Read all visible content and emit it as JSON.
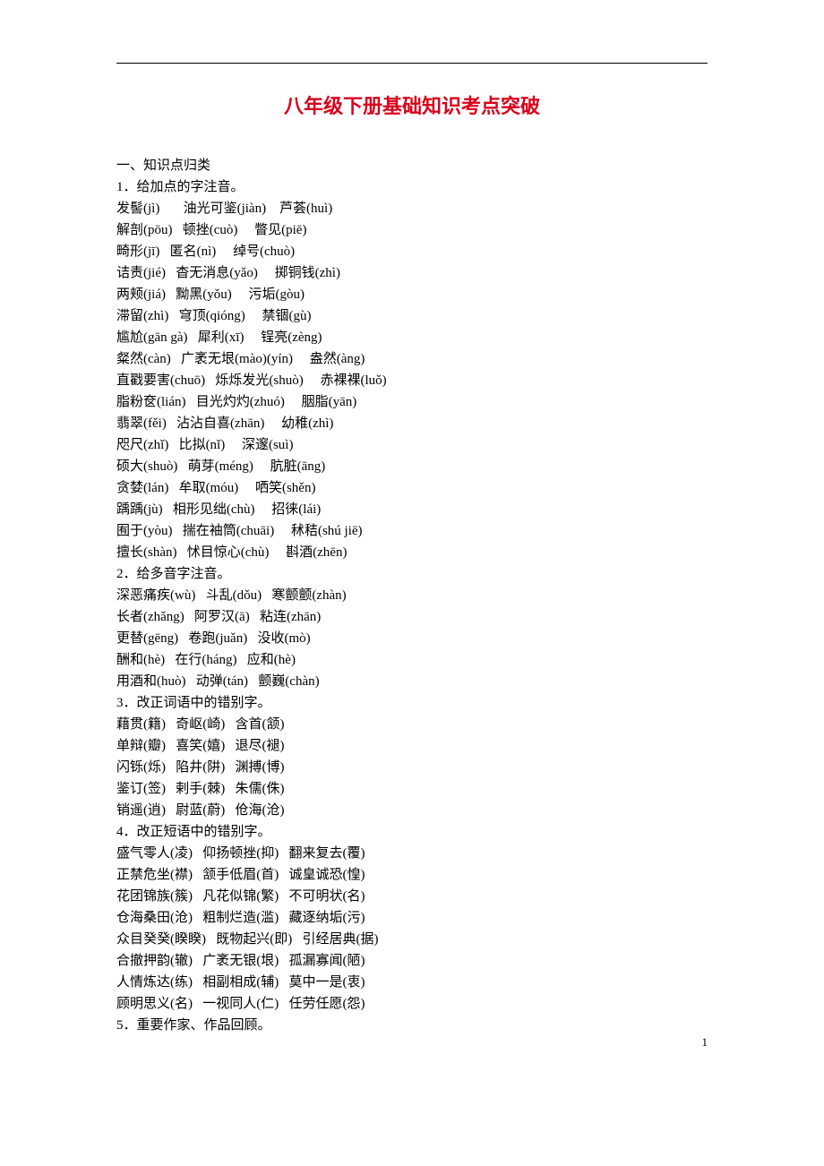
{
  "title": "八年级下册基础知识考点突破",
  "pageNumber": "1",
  "sections": [
    {
      "text": "一、知识点归类"
    },
    {
      "text": "1．给加点的字注音。"
    },
    {
      "text": "发髻(jì)       油光可鉴(jiàn)    芦荟(huì)"
    },
    {
      "text": "解剖(pōu)   顿挫(cuò)     瞥见(piē)"
    },
    {
      "text": "畸形(jī)   匿名(nì)     绰号(chuò)"
    },
    {
      "text": "诘责(jié)   杳无消息(yǎo)     掷铜钱(zhì)"
    },
    {
      "text": "两颊(jiá)   黝黑(yǒu)     污垢(gòu)"
    },
    {
      "text": "滞留(zhì)   穹顶(qióng)     禁锢(gù)"
    },
    {
      "text": "尴尬(gān gà)   犀利(xī)     锃亮(zèng)"
    },
    {
      "text": "粲然(càn)   广袤无垠(mào)(yín)     盎然(àng)"
    },
    {
      "text": "直戳要害(chuō)   烁烁发光(shuò)     赤裸裸(luǒ)"
    },
    {
      "text": "脂粉奁(lián)   目光灼灼(zhuó)     胭脂(yān)"
    },
    {
      "text": "翡翠(fěi)   沾沾自喜(zhān)     幼稚(zhì)"
    },
    {
      "text": "咫尺(zhǐ)   比拟(nǐ)     深邃(suì)"
    },
    {
      "text": "硕大(shuò)   萌芽(méng)     肮脏(āng)"
    },
    {
      "text": "贪婪(lán)   牟取(móu)     哂笑(shěn)"
    },
    {
      "text": "踽踽(jù)   相形见绌(chù)     招徕(lái)"
    },
    {
      "text": "囿于(yòu)   揣在袖筒(chuāi)     秫秸(shú jiē)"
    },
    {
      "text": "擅长(shàn)   怵目惊心(chù)     斟酒(zhēn)"
    },
    {
      "text": "2．给多音字注音。"
    },
    {
      "text": "深恶痛疾(wù)   斗乱(dǒu)   寒颤颤(zhàn)"
    },
    {
      "text": "长者(zhǎng)   阿罗汉(ā)   粘连(zhān)"
    },
    {
      "text": "更替(gēng)   卷跑(juǎn)   没收(mò)"
    },
    {
      "text": "酬和(hè)   在行(háng)   应和(hè)"
    },
    {
      "text": "用酒和(huò)   动弹(tán)   颤巍(chàn)"
    },
    {
      "text": "3．改正词语中的错别字。"
    },
    {
      "text": "藉贯(籍)   奇岖(崎)   含首(颔)"
    },
    {
      "text": "单辩(瓣)   喜笑(嬉)   退尽(褪)"
    },
    {
      "text": "闪铄(烁)   陷井(阱)   渊搏(博)"
    },
    {
      "text": "鉴订(签)   剌手(棘)   朱儒(侏)"
    },
    {
      "text": "销遥(逍)   尉蓝(蔚)   伧海(沧)"
    },
    {
      "text": "4．改正短语中的错别字。"
    },
    {
      "text": "盛气零人(凌)   仰扬顿挫(抑)   翻来复去(覆)"
    },
    {
      "text": "正禁危坐(襟)   颔手低眉(首)   诚皇诚恐(惶)"
    },
    {
      "text": "花团锦族(簇)   凡花似锦(繁)   不可明状(名)"
    },
    {
      "text": "仓海桑田(沧)   粗制烂造(滥)   藏逐纳垢(污)"
    },
    {
      "text": "众目癸癸(睽睽)   既物起兴(即)   引经居典(据)"
    },
    {
      "text": "合撤押韵(辙)   广袤无银(垠)   孤漏寡闻(陋)"
    },
    {
      "text": "人情炼达(练)   相副相成(辅)   莫中一是(衷)"
    },
    {
      "text": "顾明思义(名)   一视同人(仁)   任劳任愿(怨)"
    },
    {
      "text": "5．重要作家、作品回顾。"
    }
  ]
}
